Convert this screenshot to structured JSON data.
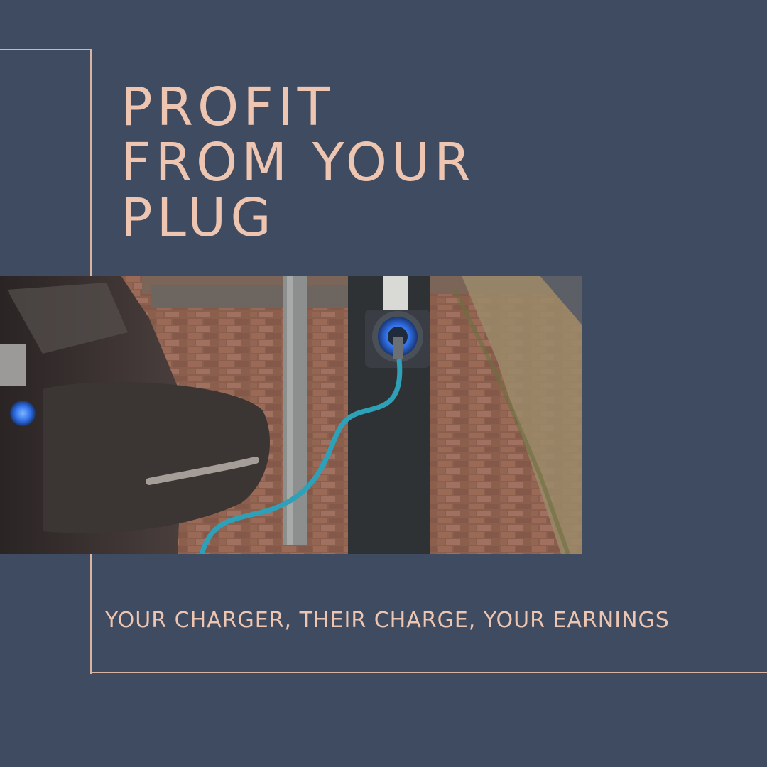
{
  "headline": {
    "line1": "PROFIT",
    "line2": "FROM YOUR",
    "line3": "PLUG"
  },
  "tagline": "YOUR CHARGER, THEIR CHARGE, YOUR EARNINGS",
  "photo": {
    "subject": "ev-charging-station"
  },
  "colors": {
    "background": "#3f4b60",
    "accent": "#edc5b0",
    "frame_line": "#d9b4a0",
    "charger_glow": "#2f7bff",
    "cable": "#2ea0b8"
  }
}
